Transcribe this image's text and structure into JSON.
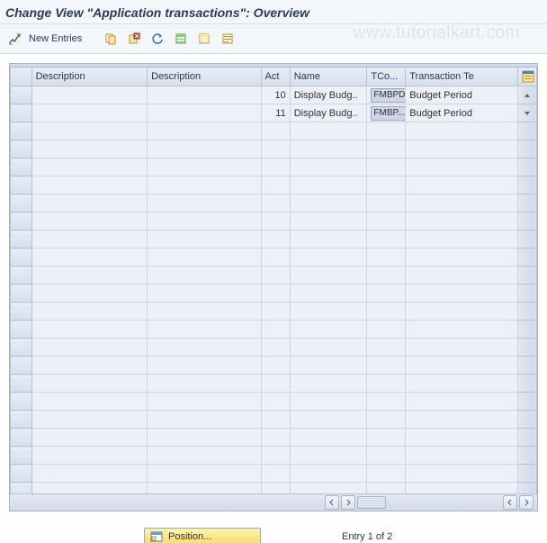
{
  "title": "Change View \"Application transactions\": Overview",
  "watermark": "www.tutorialkart.com",
  "toolbar": {
    "new_entries_label": "New Entries",
    "icons": {
      "toggle": "toggle-icon",
      "new_entries": "new-entries-icon",
      "copy": "copy-icon",
      "delete": "delete-icon",
      "undo": "undo-icon",
      "select_all": "select-all-icon",
      "deselect_all": "deselect-all-icon",
      "variant": "variant-icon"
    }
  },
  "columns": {
    "marker": "",
    "desc1": "Description",
    "desc2": "Description",
    "act": "Act",
    "name": "Name",
    "tco": "TCo...",
    "tt": "Transaction Te"
  },
  "rows": [
    {
      "desc1": "",
      "desc2": "",
      "act": "10",
      "name": "Display Budg..",
      "tco": "FMBPD",
      "tt": "Budget Period"
    },
    {
      "desc1": "",
      "desc2": "",
      "act": "11",
      "name": "Display Budg..",
      "tco": "FMBP...",
      "tt": "Budget Period"
    }
  ],
  "blank_row_count": 21,
  "footer": {
    "position_label": "Position...",
    "entry_text": "Entry 1 of 2"
  }
}
